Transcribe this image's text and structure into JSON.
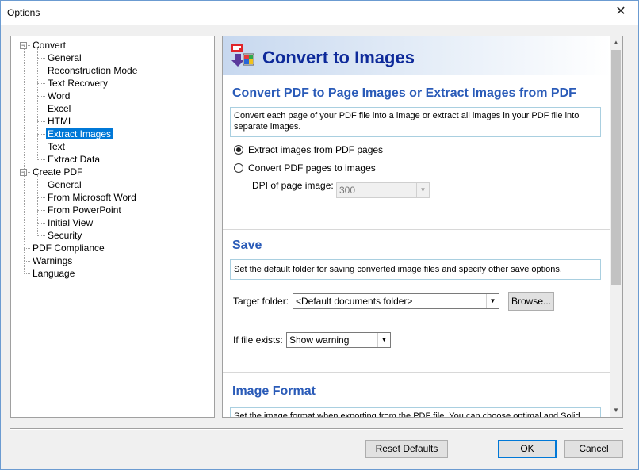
{
  "window": {
    "title": "Options",
    "close_glyph": "✕"
  },
  "tree": [
    {
      "label": "Convert",
      "level": 0,
      "expander": "−"
    },
    {
      "label": "General",
      "level": 1
    },
    {
      "label": "Reconstruction Mode",
      "level": 1
    },
    {
      "label": "Text Recovery",
      "level": 1
    },
    {
      "label": "Word",
      "level": 1
    },
    {
      "label": "Excel",
      "level": 1
    },
    {
      "label": "HTML",
      "level": 1
    },
    {
      "label": "Extract Images",
      "level": 1,
      "selected": true
    },
    {
      "label": "Text",
      "level": 1
    },
    {
      "label": "Extract Data",
      "level": 1
    },
    {
      "label": "Create PDF",
      "level": 0,
      "expander": "−"
    },
    {
      "label": "General",
      "level": 1
    },
    {
      "label": "From Microsoft Word",
      "level": 1
    },
    {
      "label": "From PowerPoint",
      "level": 1
    },
    {
      "label": "Initial View",
      "level": 1
    },
    {
      "label": "Security",
      "level": 1
    },
    {
      "label": "PDF Compliance",
      "level": 0
    },
    {
      "label": "Warnings",
      "level": 0
    },
    {
      "label": "Language",
      "level": 0
    }
  ],
  "panel": {
    "header_title": "Convert to Images",
    "convert_section": {
      "heading": "Convert PDF to Page Images or Extract Images from PDF",
      "description": "Convert each page of your PDF file into a image or extract all images in your PDF file into separate images.",
      "radio_extract": "Extract images from PDF pages",
      "radio_convert": "Convert PDF pages to images",
      "dpi_label": "DPI of page image:",
      "dpi_value": "300"
    },
    "save_section": {
      "heading": "Save",
      "description": "Set the default folder for saving converted image files and specify other save options.",
      "target_label": "Target folder:",
      "target_value": "<Default documents folder>",
      "browse_label": "Browse...",
      "exists_label": "If file exists:",
      "exists_value": "Show warning"
    },
    "format_section": {
      "heading": "Image Format",
      "description": "Set the image format when exporting from the PDF file. You can choose optimal and Solid PDF"
    }
  },
  "footer": {
    "reset_label": "Reset Defaults",
    "ok_label": "OK",
    "cancel_label": "Cancel"
  },
  "colors": {
    "accent": "#0078d7",
    "heading": "#2a5bb8",
    "header_title": "#0e2a9a"
  }
}
